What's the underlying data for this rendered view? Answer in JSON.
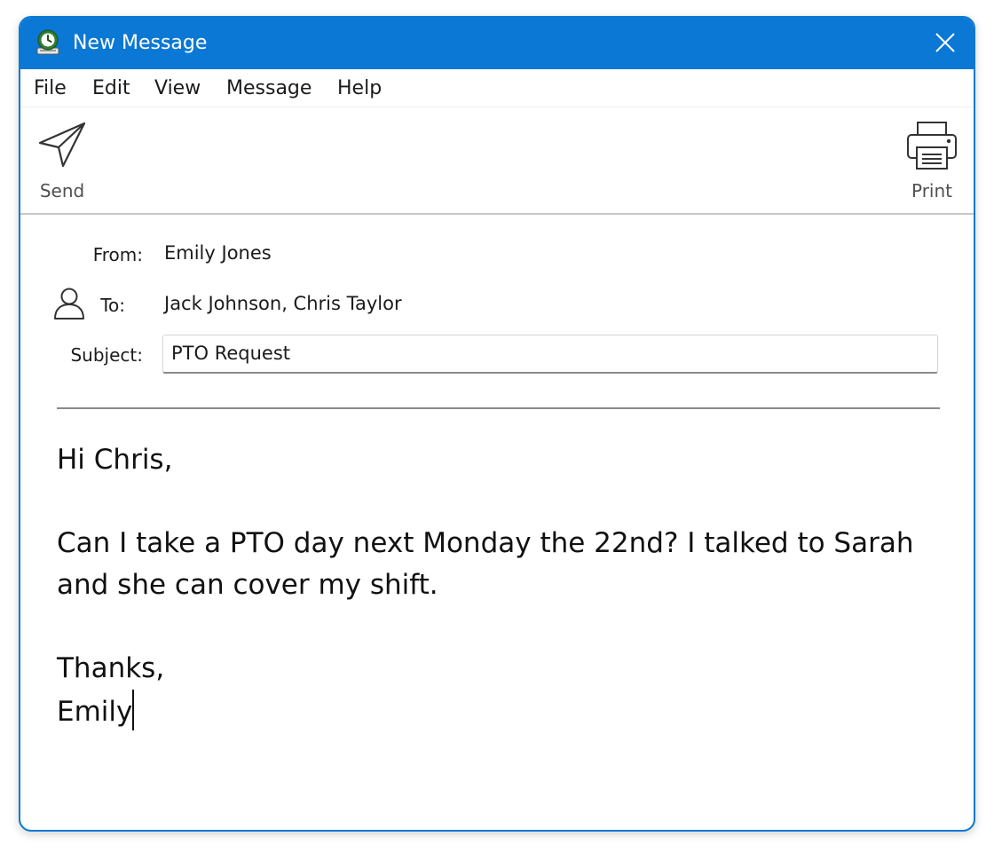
{
  "window": {
    "title": "New Message",
    "accent_color": "#0a78d4",
    "app_icon": "mail-app-icon",
    "close_icon": "close-icon"
  },
  "menu": [
    "File",
    "Edit",
    "View",
    "Message",
    "Help"
  ],
  "toolbar": {
    "send_label": "Send",
    "send_icon": "paper-plane-icon",
    "print_label": "Print",
    "print_icon": "printer-icon"
  },
  "header": {
    "from_label": "From:",
    "from_value": "Emily Jones",
    "to_label": "To:",
    "to_value": "Jack Johnson, Chris Taylor",
    "to_icon": "person-icon",
    "subject_label": "Subject:",
    "subject_value": "PTO Request"
  },
  "body": {
    "text": "Hi Chris,\n\nCan I take a PTO day next Monday the 22nd? I talked to Sarah\nand she can cover my shift.\n\nThanks,\nEmily"
  }
}
